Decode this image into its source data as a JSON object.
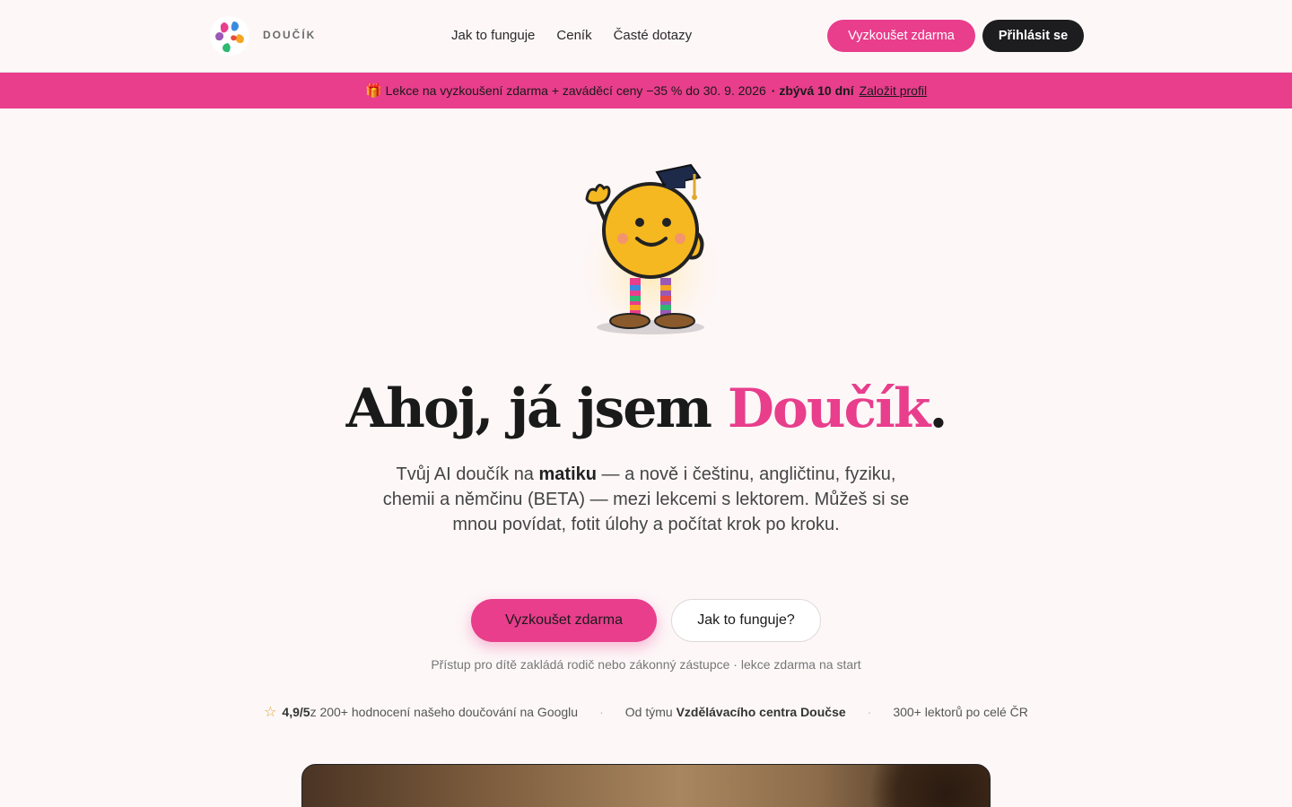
{
  "header": {
    "brand": "DOUČÍK",
    "nav": [
      "Jak to funguje",
      "Ceník",
      "Časté dotazy"
    ],
    "try_button": "Vyzkoušet zdarma",
    "login_button": "Přihlásit se"
  },
  "promo": {
    "text": "Lekce na vyzkoušení zdarma + zaváděcí ceny −35 % do 30. 9. 2026",
    "remaining": "· zbývá 10 dní",
    "link": "Založit profil"
  },
  "hero": {
    "title_prefix": "Ahoj, já jsem ",
    "title_accent": "Doučík",
    "title_suffix": ".",
    "sub_1": "Tvůj AI doučík na ",
    "sub_bold": "matiku",
    "sub_2": " — a nově i češtinu, angličtinu, fyziku, chemii a němčinu (BETA) — mezi lekcemi s lektorem. Můžeš si se mnou povídat, fotit úlohy a počítat krok po kroku.",
    "try_button": "Vyzkoušet zdarma",
    "how_button": "Jak to funguje?",
    "access_note": "Přístup pro dítě zakládá rodič nebo zákonný zástupce · lekce zdarma na start"
  },
  "stats": {
    "rating": "4,9/5",
    "rating_text": " z 200+ hodnocení našeho doučování na Googlu",
    "team_prefix": "Od týmu ",
    "team_name": "Vzdělávacího centra Doučse",
    "tutors": "300+ lektorů po celé ČR"
  },
  "colors": {
    "accent": "#e83e8c",
    "dark": "#1d1d1f",
    "background": "#fdf7f8"
  },
  "icons": {
    "gift": "gift-icon",
    "star": "star-icon",
    "logo": "hands-logo-icon",
    "mascot": "mascot-illustration"
  }
}
